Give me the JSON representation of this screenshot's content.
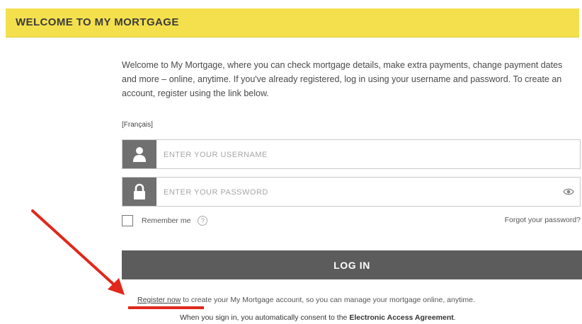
{
  "header": {
    "title": "WELCOME TO MY MORTGAGE"
  },
  "intro": {
    "text": "Welcome to My Mortgage, where you can check mortgage details, make extra payments, change payment dates and more – online, anytime. If you've already registered, log in using your username and password. To create an account, register using the link below."
  },
  "language_link": "[Français]",
  "username": {
    "placeholder": "ENTER YOUR USERNAME",
    "value": "",
    "icon": "user-icon"
  },
  "password": {
    "placeholder": "ENTER YOUR PASSWORD",
    "value": "",
    "icon": "lock-icon",
    "toggle_icon": "eye-icon"
  },
  "remember": {
    "label": "Remember me",
    "checked": false,
    "help_glyph": "?"
  },
  "forgot_link": "Forgot your password?",
  "login_button": "LOG IN",
  "register": {
    "link": "Register now",
    "text": " to create your My Mortgage account, so you can manage your mortgage online, anytime."
  },
  "consent": {
    "text": "When you sign in, you automatically consent to the ",
    "link": "Electronic Access Agreement",
    "suffix": "."
  },
  "colors": {
    "header_bg": "#f4e04d",
    "button_bg": "#5c5c5c",
    "icon_bg": "#707070",
    "annotation_red": "#e0281b"
  }
}
